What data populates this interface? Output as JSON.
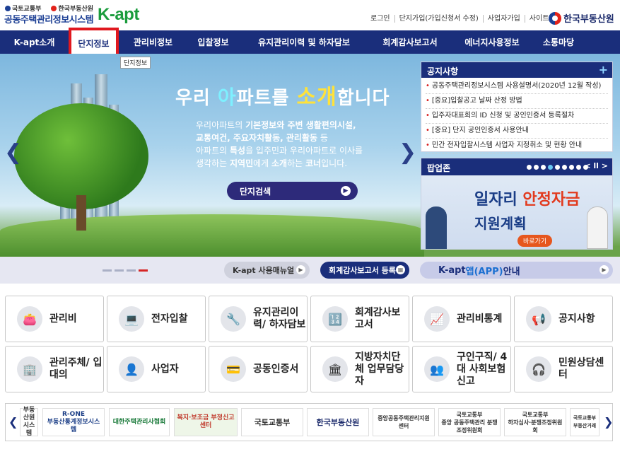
{
  "header": {
    "ministry1": "국토교통부",
    "ministry2": "한국부동산원",
    "system_name": "공동주택관리정보시스템",
    "logo": "K-apt",
    "utils": [
      "로그인",
      "단지가입(가입신청서 수정)",
      "사업자가입",
      "사이트맵"
    ],
    "brand": "한국부동산원"
  },
  "nav": {
    "items": [
      "K-apt소개",
      "단지정보",
      "관리비정보",
      "입찰정보",
      "유지관리이력 및 하자담보",
      "회계감사보고서",
      "에너지사용정보",
      "소통마당"
    ],
    "tooltip": "단지정보"
  },
  "hero": {
    "title_pre": "우리 ",
    "title_a": "아",
    "title_mid1": "파트를 ",
    "title_so": "소",
    "title_gae": "개",
    "title_post": "합니다",
    "desc1_pre": "우리아파트의 ",
    "desc1_b": "기본정보와 주변 생활편의시설,",
    "desc2_b": "교통여건, 주요자치활동, 관리활동",
    "desc2_post": " 등",
    "desc3_pre": "아파트의 ",
    "desc3_b": "특성",
    "desc3_post": "을 입주민과 우리아파트로 이사를",
    "desc4_pre": "생각하는 ",
    "desc4_b": "지역민",
    "desc4_mid": "에게 ",
    "desc4_b2": "소개",
    "desc4_mid2": "하는 ",
    "desc4_b3": "코너",
    "desc4_post": "입니다.",
    "search_button": "단지검색"
  },
  "notice": {
    "title": "공지사항",
    "items": [
      "공동주택관리정보시스템 사용설명서(2020년 12월 작성)",
      "[중요]입찰공고 날짜 산정 방법",
      "입주자대표회의 ID 신청 및 공인인증서 등록절차",
      "[중요] 단지 공인인증서 사용안내",
      "민간 전자입찰시스템 사업자 지정취소 및 현황 안내"
    ]
  },
  "popup": {
    "title": "팝업존",
    "controls": "< ll >",
    "line1_pre": "일자리 ",
    "line1_red": "안정자금",
    "line2": "지원계획",
    "button": "바로가기"
  },
  "quickbar": {
    "manual": "K-apt 사용매뉴얼",
    "audit": "회계감사보고서 등록",
    "app_pre": "K-apt ",
    "app_blue": "앱(APP)",
    "app_post": " 안내"
  },
  "tiles": [
    {
      "label": "관리비",
      "icon": "wallet-icon"
    },
    {
      "label": "전자입찰",
      "icon": "monitor-icon"
    },
    {
      "label": "유지관리이력/ 하자담보",
      "icon": "tools-icon"
    },
    {
      "label": "회계감사보고서",
      "icon": "calculator-icon"
    },
    {
      "label": "관리비통계",
      "icon": "chart-icon"
    },
    {
      "label": "공지사항",
      "icon": "megaphone-icon"
    },
    {
      "label": "관리주체/ 입대의",
      "icon": "building-icon"
    },
    {
      "label": "사업자",
      "icon": "person-icon"
    },
    {
      "label": "공동인증서",
      "icon": "certificate-icon"
    },
    {
      "label": "지방자치단체 업무담당자",
      "icon": "government-icon"
    },
    {
      "label": "구인구직/ 4대 사회보험 신고",
      "icon": "people-icon"
    },
    {
      "label": "민원상담센터",
      "icon": "headset-icon"
    }
  ],
  "partners": [
    "부동산원\n시스템",
    "R-ONE\n부동산통계정보시스템",
    "대한주택관리사협회",
    "복지·보조금 부정신고센터",
    "국토교통부",
    "한국부동산원",
    "중앙공동주택관리지원센터",
    "국토교통부\n중앙 공동주택관리 분쟁조정위원회",
    "국토교통부\n하자심사·분쟁조정위원회",
    "국토교통부\n부동산거래"
  ]
}
